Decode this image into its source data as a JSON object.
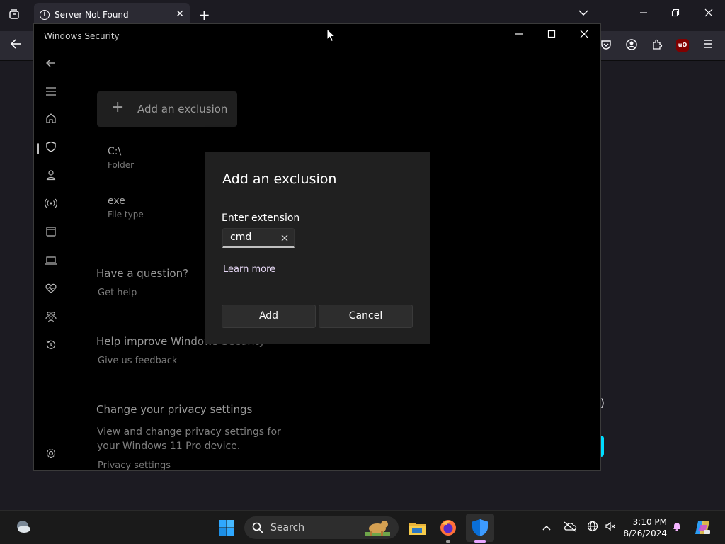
{
  "browser": {
    "tab_title": "Server Not Found",
    "new_tab_icon": "+",
    "close_icon": "✕",
    "background_paren": ")"
  },
  "ws": {
    "title": "Windows Security",
    "add_exclusion_label": "Add an exclusion",
    "exclusions": [
      {
        "name": "C:\\",
        "kind": "Folder"
      },
      {
        "name": "exe",
        "kind": "File type"
      }
    ],
    "question_heading": "Have a question?",
    "get_help": "Get help",
    "improve_heading": "Help improve Windows Security",
    "feedback": "Give us feedback",
    "privacy_heading": "Change your privacy settings",
    "privacy_text": "View and change privacy settings for your Windows 11 Pro device.",
    "privacy_link": "Privacy settings"
  },
  "dialog": {
    "title": "Add an exclusion",
    "field_label": "Enter extension",
    "input_value": "cmd",
    "learn_more": "Learn more",
    "add_label": "Add",
    "cancel_label": "Cancel"
  },
  "taskbar": {
    "search_label": "Search",
    "time": "3:10 PM",
    "date": "8/26/2024"
  },
  "colors": {
    "accent_cyan": "#00ddff",
    "shield_blue": "#0a6fd8"
  }
}
